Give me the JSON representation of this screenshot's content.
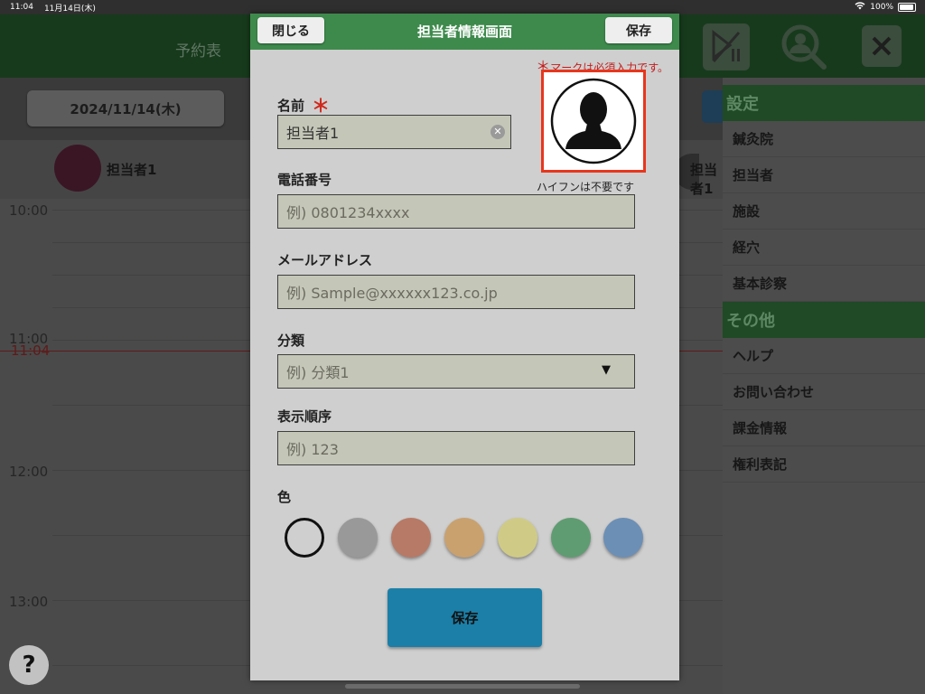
{
  "status_bar": {
    "time": "11:04",
    "date": "11月14日(木)",
    "battery": "100%"
  },
  "background": {
    "title": "予約表",
    "date_button": "2024/11/14(木)",
    "staff": [
      {
        "name": "担当者1"
      },
      {
        "name": "担当者1"
      }
    ],
    "time_labels": [
      "10:00",
      "11:00",
      "12:00",
      "13:00"
    ],
    "now_label": "11:04",
    "help": "?"
  },
  "side_menu": {
    "sections": [
      {
        "header": "設定",
        "items": [
          "鍼灸院",
          "担当者",
          "施設",
          "経穴",
          "基本診察"
        ]
      },
      {
        "header": "その他",
        "items": [
          "ヘルプ",
          "お問い合わせ",
          "課金情報",
          "権利表記"
        ]
      }
    ]
  },
  "modal": {
    "title": "担当者情報画面",
    "close_label": "閉じる",
    "save_label": "保存",
    "required_note": "マークは必須入力です。",
    "required_star": "＊",
    "fields": {
      "name": {
        "label": "名前",
        "value": "担当者1",
        "required_mark": "＊"
      },
      "phone": {
        "label": "電話番号",
        "placeholder": "例) 0801234xxxx",
        "hint": "ハイフンは不要です"
      },
      "email": {
        "label": "メールアドレス",
        "placeholder": "例) Sample@xxxxxx123.co.jp"
      },
      "category": {
        "label": "分類",
        "placeholder": "例) 分類1"
      },
      "order": {
        "label": "表示順序",
        "placeholder": "例) 123"
      }
    },
    "color": {
      "label": "色",
      "swatches": [
        "none",
        "#999999",
        "#b77a66",
        "#c9a16f",
        "#cfcb86",
        "#5f9c72",
        "#6c8fb5"
      ],
      "selected": "none"
    },
    "bottom_save_label": "保存"
  }
}
